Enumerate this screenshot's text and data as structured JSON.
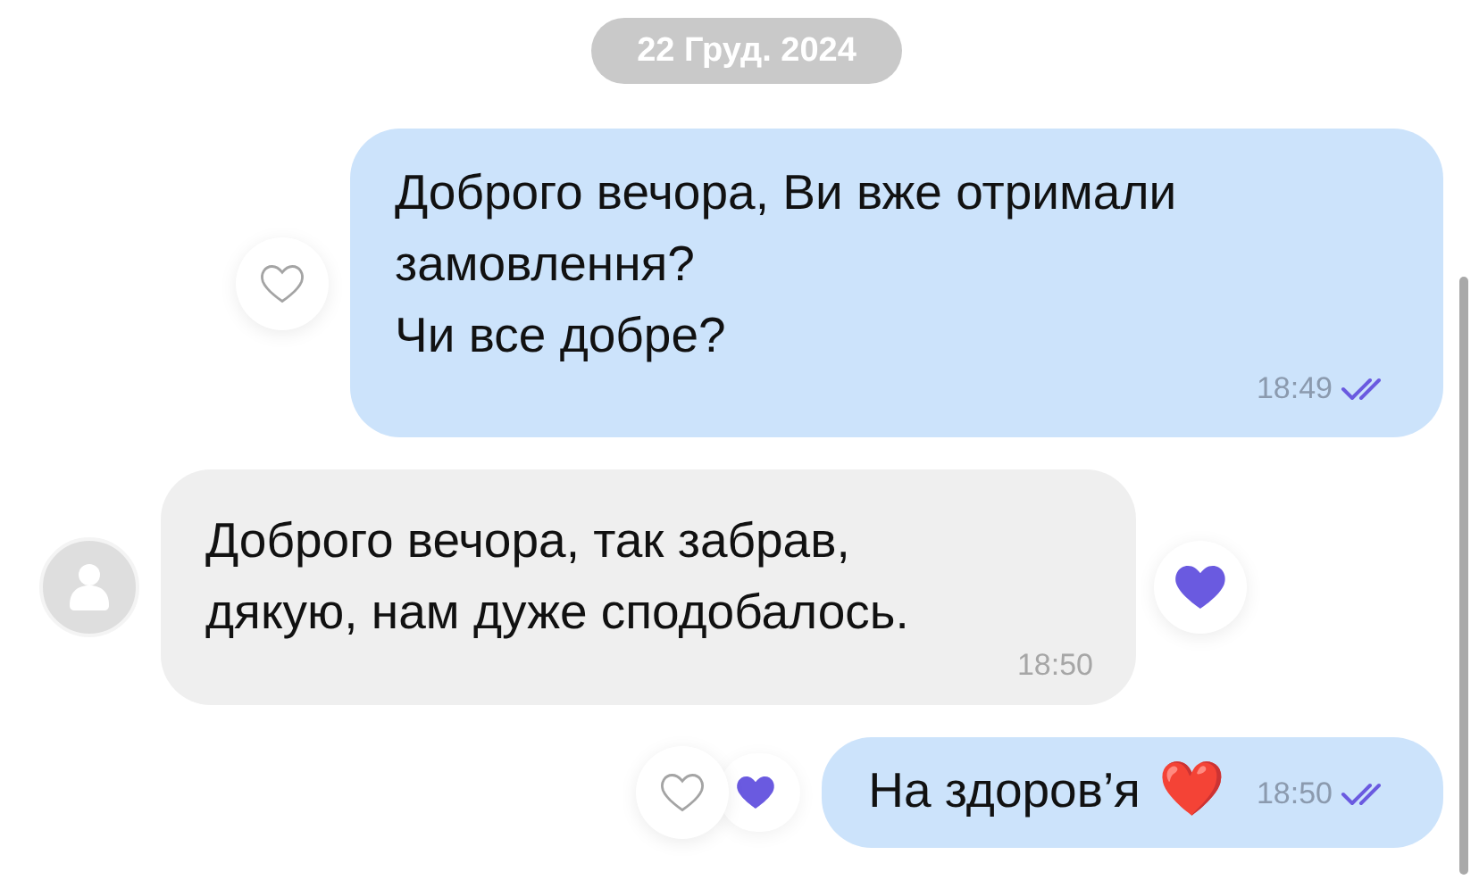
{
  "date_separator": "22 Груд. 2024",
  "messages": [
    {
      "kind": "outgoing",
      "text": "Доброго вечора, Ви вже отримали\nзамовлення?\nЧи все добре?",
      "time": "18:49",
      "read": true,
      "meta_inline": false,
      "like_button": true,
      "reacted": false
    },
    {
      "kind": "incoming",
      "text": "Доброго вечора, так забрав,\nдякую, нам дуже сподобалось.",
      "time": "18:50",
      "meta_inline": false,
      "like_button": false,
      "reacted": true
    },
    {
      "kind": "outgoing",
      "text": "На здоров’я",
      "emoji": "❤️",
      "time": "18:50",
      "read": true,
      "meta_inline": true,
      "like_button": true,
      "reacted": true
    }
  ]
}
